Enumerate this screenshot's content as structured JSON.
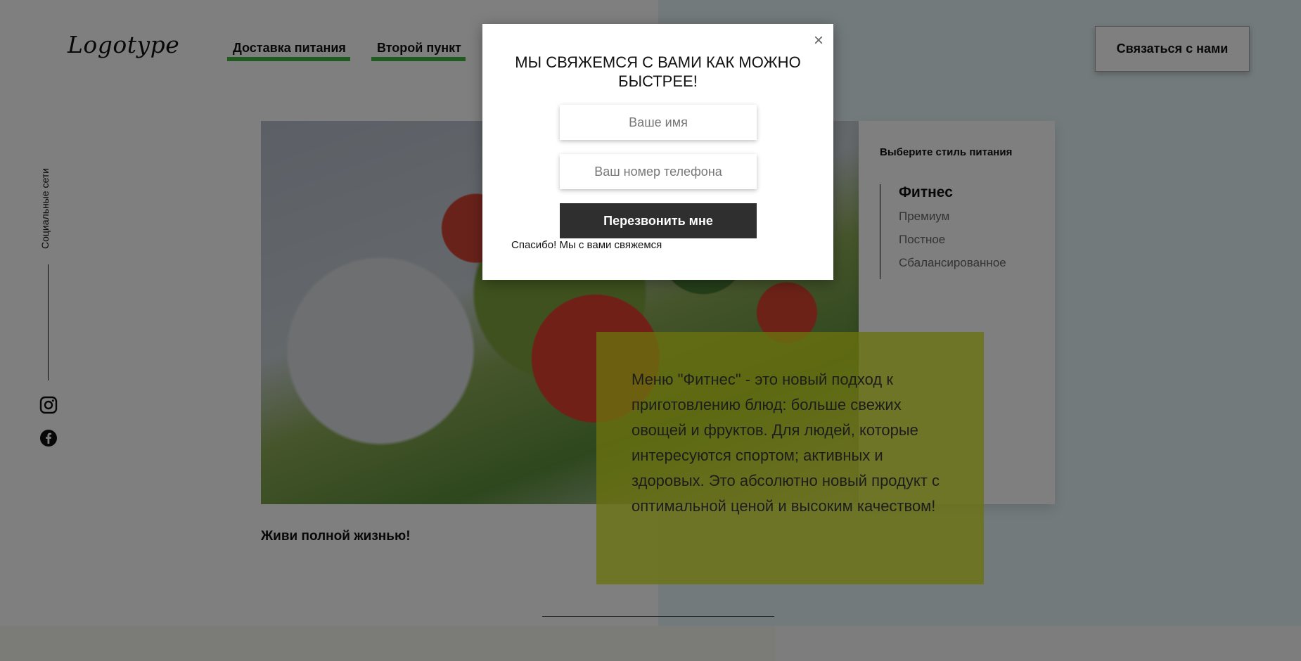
{
  "header": {
    "logo": "Logotype",
    "nav": [
      "Доставка питания",
      "Второй пункт"
    ],
    "contact_button": "Связаться с нами"
  },
  "social": {
    "label": "Социальные сети",
    "icons": [
      "instagram-icon",
      "facebook-icon"
    ]
  },
  "main": {
    "side_title": "Выберите стиль питания",
    "menu": [
      "Фитнес",
      "Премиум",
      "Постное",
      "Сбалансированное"
    ],
    "description": "Меню \"Фитнес\" - это новый подход к приготовлению блюд: больше свежих овощей и фруктов. Для людей, которые интересуются спортом; активных и здоровых. Это абсолютно новый продукт с оптимальной ценой и высоким качеством!",
    "tagline": "Живи полной жизнью!"
  },
  "modal": {
    "close": "×",
    "title": "МЫ СВЯЖЕМСЯ С ВАМИ КАК МОЖНО БЫСТРЕЕ!",
    "name_placeholder": "Ваше имя",
    "phone_placeholder": "Ваш номер телефона",
    "button": "Перезвонить мне",
    "thanks": "Спасибо! Мы с вами свяжемся"
  },
  "colors": {
    "accent_underline": "#3fb53f",
    "yellow_block": "#d6e51d",
    "button_dark": "#2f2f2f"
  }
}
